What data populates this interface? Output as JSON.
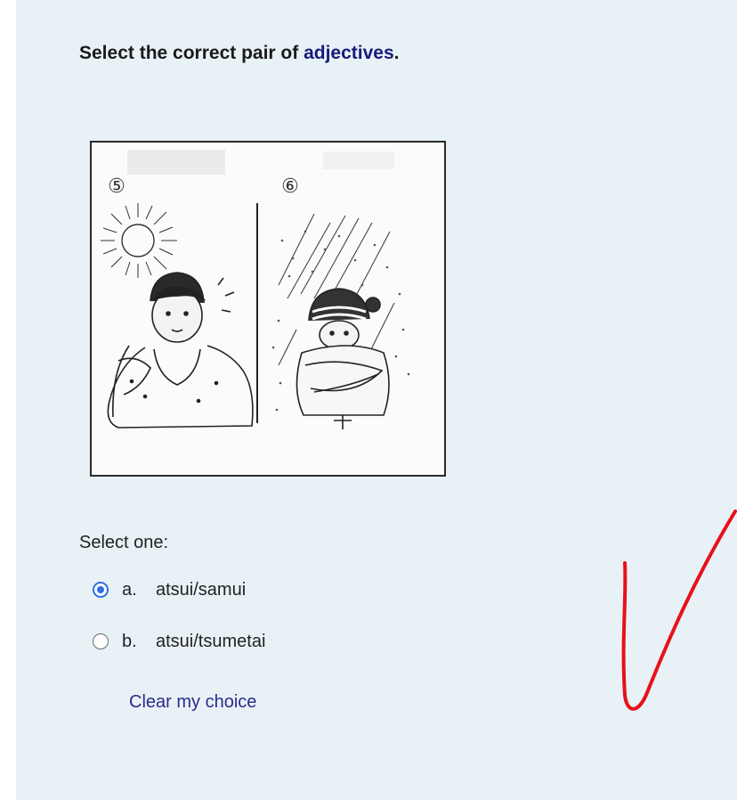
{
  "question": {
    "prompt_prefix": "Select the correct pair of ",
    "prompt_keyword": "adjectives",
    "prompt_suffix": ".",
    "figure": {
      "panel_left_number": "⑤",
      "panel_right_number": "⑥"
    },
    "select_label": "Select one:",
    "options": [
      {
        "letter": "a.",
        "text": "atsui/samui",
        "selected": true
      },
      {
        "letter": "b.",
        "text": "atsui/tsumetai",
        "selected": false
      }
    ],
    "clear_label": "Clear my choice"
  },
  "colors": {
    "panel_background": "#e7f0f4",
    "keyword": "#1a1a7a",
    "radio_selected": "#2f6fdf",
    "link": "#2c2a8c",
    "check_mark": "#e8101a"
  },
  "icons": {
    "selected_radio": "radio-checked-icon",
    "unselected_radio": "radio-unchecked-icon",
    "check_mark": "handwritten-check-icon"
  }
}
